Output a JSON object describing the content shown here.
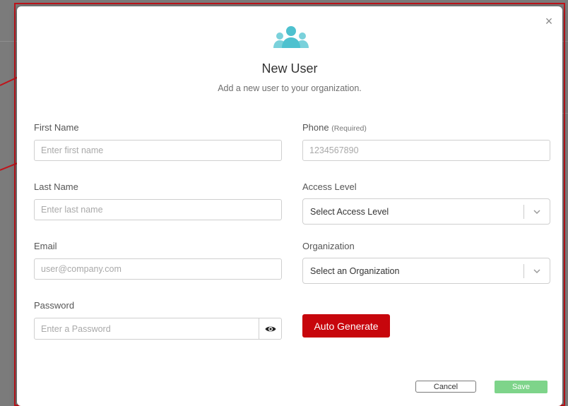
{
  "dialog": {
    "title": "New User",
    "subtitle": "Add a new user to your organization.",
    "close_symbol": "×",
    "icon": "users-group-icon",
    "icon_color": "#4ec1cf"
  },
  "fields": {
    "first_name": {
      "label": "First Name",
      "placeholder": "Enter first name"
    },
    "last_name": {
      "label": "Last Name",
      "placeholder": "Enter last name"
    },
    "email": {
      "label": "Email",
      "placeholder": "user@company.com"
    },
    "password": {
      "label": "Password",
      "placeholder": "Enter a Password"
    },
    "phone": {
      "label": "Phone",
      "label_note": "(Required)",
      "placeholder": "1234567890"
    },
    "access_level": {
      "label": "Access Level",
      "value": "Select Access Level"
    },
    "organization": {
      "label": "Organization",
      "value": "Select an Organization"
    }
  },
  "buttons": {
    "auto_generate": "Auto Generate",
    "cancel": "Cancel",
    "save": "Save"
  },
  "colors": {
    "primary_red": "#c7060c",
    "save_green": "#7ed48a",
    "overlay_gray": "#7b7b7b"
  }
}
